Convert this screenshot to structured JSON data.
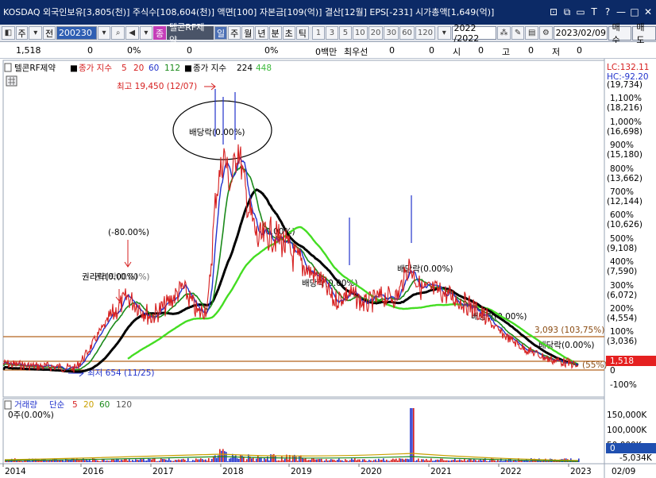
{
  "titlebar": {
    "text": "KOSDAQ 외국인보유[3,805(천)] 주식수[108,604(천)] 액면[100] 자본금[109(억)] 결산[12월] EPS[-231] 시가총액[1,649(억)]",
    "buttons": [
      "?",
      "□",
      "□",
      "T",
      "?",
      "—",
      "□",
      "×"
    ]
  },
  "toolbar": {
    "period_unit": "주",
    "prev_label": "전",
    "stock_code": "200230",
    "stock_name": "텔콘RF제약",
    "stock_badge": "종",
    "period_tabs": [
      "일",
      "주",
      "월",
      "년",
      "분",
      "초",
      "틱"
    ],
    "active_tab": "일",
    "numbers": [
      "1",
      "3",
      "5",
      "10",
      "20",
      "30",
      "60",
      "120"
    ],
    "range": "2022 /2022",
    "date": "2023/02/09",
    "buy_label": "매수",
    "sell_label": "매도"
  },
  "infobar": {
    "price": "1,518",
    "change": "0",
    "change_pct": "0%",
    "volume": "0",
    "volume_pct": "0%",
    "trade_value": "0백만",
    "best_bid_label": "최우선",
    "bid": "0",
    "ask": "0",
    "open_label": "시",
    "open": "0",
    "high_label": "고",
    "high": "0",
    "low_label": "저",
    "low": "0"
  },
  "legend": {
    "name": "텔콘RF제약",
    "ma_label": "종가 지수",
    "ma_values": [
      "5",
      "20",
      "60",
      "112"
    ],
    "ma2_label": "종가 지수",
    "ma2_values": [
      "224",
      "448"
    ],
    "volume_label": "거래량",
    "volume_ma_label": "단순",
    "volume_ma_values": [
      "5",
      "20",
      "60",
      "120"
    ],
    "volume_info": "0주(0.00%)"
  },
  "annotations": {
    "high": "최고 19,450 (12/07)",
    "low": "최저 654 (11/25)",
    "pct_left": "(-80.00%)",
    "dividend": "배당락(0.00%)",
    "dividend_mid": "배당락(0.00%)",
    "dividend_2020": "배당락(0.00%)",
    "dividend_2022": "배당락(0.00%)",
    "dividend_right": "배당락(0.00%)",
    "drop": "(0.00%)",
    "rights": "권리락(0.00%)",
    "level": "3,093 (103,75%)",
    "current_pct": "(55%)"
  },
  "right_axis": {
    "lc": "LC:132.11",
    "hc": "HC:-92.20",
    "labels": [
      {
        "pct": "",
        "price": "(19,734)"
      },
      {
        "pct": "1,100%",
        "price": "(18,216)"
      },
      {
        "pct": "1,000%",
        "price": "(16,698)"
      },
      {
        "pct": "900%",
        "price": "(15,180)"
      },
      {
        "pct": "800%",
        "price": "(13,662)"
      },
      {
        "pct": "700%",
        "price": "(12,144)"
      },
      {
        "pct": "600%",
        "price": "(10,626)"
      },
      {
        "pct": "500%",
        "price": "(9,108)"
      },
      {
        "pct": "400%",
        "price": "(7,590)"
      },
      {
        "pct": "300%",
        "price": "(6,072)"
      },
      {
        "pct": "200%",
        "price": "(4,554)"
      },
      {
        "pct": "100%",
        "price": "(3,036)"
      }
    ],
    "current_price": "1,518",
    "zero": "0",
    "minus100": "-100%",
    "vol_labels": [
      "150,000K",
      "100,000K",
      "50,000K"
    ],
    "vol_current": "0",
    "vol_min": "-5,034K"
  },
  "x_axis": {
    "labels": [
      "2014",
      "2016",
      "2017",
      "2018",
      "2019",
      "2020",
      "2021",
      "2022",
      "2023"
    ],
    "cursor_label": "02/09"
  },
  "colors": {
    "ma5": "#d61f1f",
    "ma20": "#2233cc",
    "ma60": "#1a8a1a",
    "ma112": "#000000",
    "ma448": "#44dd22"
  }
}
